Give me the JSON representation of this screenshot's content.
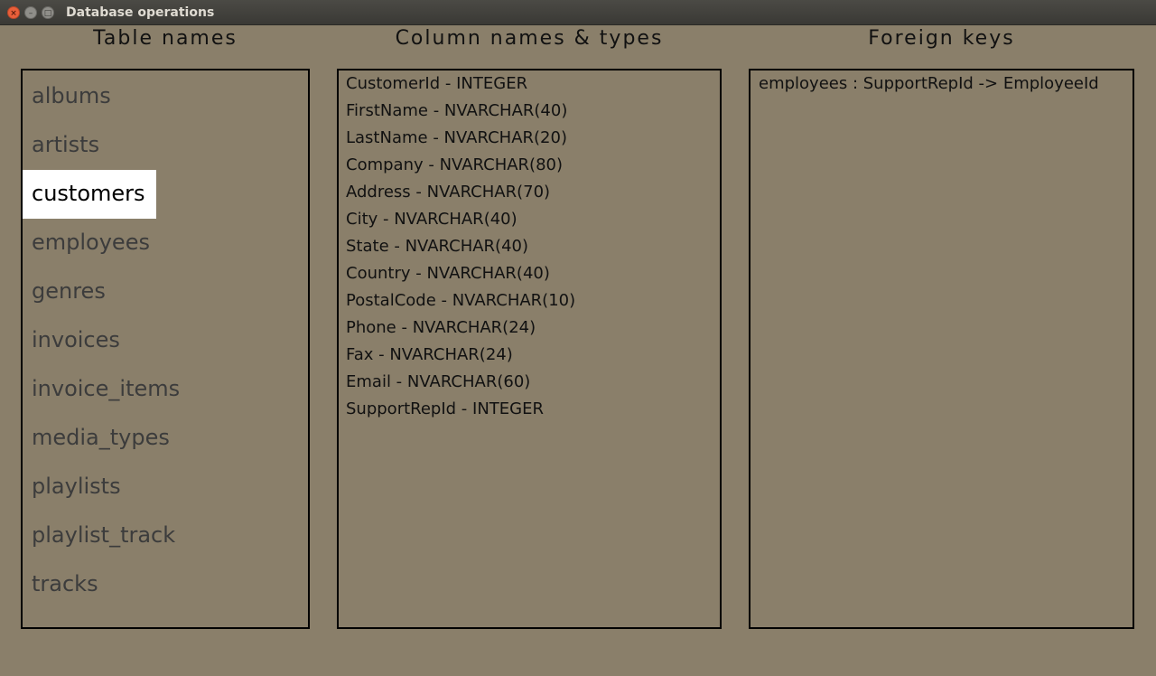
{
  "window": {
    "title": "Database operations",
    "close_glyph": "×",
    "min_glyph": "–",
    "max_glyph": "□"
  },
  "headings": {
    "tables": "Table names",
    "columns": "Column names & types",
    "foreign_keys": "Foreign keys"
  },
  "tables": [
    "albums",
    "artists",
    "customers",
    "employees",
    "genres",
    "invoices",
    "invoice_items",
    "media_types",
    "playlists",
    "playlist_track",
    "tracks"
  ],
  "selected_table": "customers",
  "columns": [
    "CustomerId - INTEGER",
    "FirstName - NVARCHAR(40)",
    "LastName - NVARCHAR(20)",
    "Company - NVARCHAR(80)",
    "Address - NVARCHAR(70)",
    "City - NVARCHAR(40)",
    "State - NVARCHAR(40)",
    "Country - NVARCHAR(40)",
    "PostalCode - NVARCHAR(10)",
    "Phone - NVARCHAR(24)",
    "Fax - NVARCHAR(24)",
    "Email - NVARCHAR(60)",
    "SupportRepId - INTEGER"
  ],
  "foreign_keys": [
    "employees : SupportRepId -> EmployeeId"
  ],
  "colors": {
    "background": "#8a7f6a",
    "selection": "#ffffff",
    "close_button": "#e95f3a"
  }
}
